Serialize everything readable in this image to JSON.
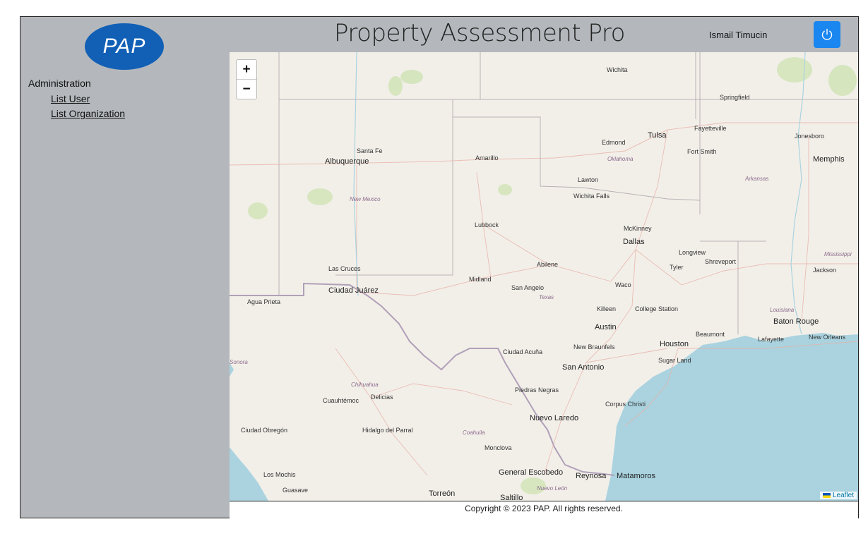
{
  "sidebar": {
    "logo_text": "PAP",
    "section_title": "Administration",
    "items": [
      {
        "label": "List User"
      },
      {
        "label": "List Organization"
      }
    ]
  },
  "header": {
    "title": "Property Assessment Pro",
    "user_name": "Ismail Timucin",
    "logout_icon": "power-icon"
  },
  "map": {
    "zoom_in": "+",
    "zoom_out": "−",
    "attribution": "Leaflet",
    "regions": [
      "New Mexico",
      "Oklahoma",
      "Arkansas",
      "Texas",
      "Louisiana",
      "Mississippi",
      "Chihuahua",
      "Coahuila",
      "Nuevo León",
      "Sonora"
    ],
    "cities": [
      "Wichita",
      "Springfield",
      "Tulsa",
      "Fayetteville",
      "Jonesboro",
      "Edmond",
      "Fort Smith",
      "Memphis",
      "Santa Fe",
      "Albuquerque",
      "Amarillo",
      "Lawton",
      "Wichita Falls",
      "Lubbock",
      "McKinney",
      "Dallas",
      "Longview",
      "Tyler",
      "Shreveport",
      "Jackson",
      "Las Cruces",
      "Abilene",
      "Ciudad Juárez",
      "Midland",
      "San Angelo",
      "Waco",
      "Agua Prieta",
      "Killeen",
      "College Station",
      "Baton Rouge",
      "Austin",
      "Beaumont",
      "Lafayette",
      "New Orleans",
      "New Braunfels",
      "Houston",
      "Sugar Land",
      "Ciudad Acuña",
      "San Antonio",
      "Piedras Negras",
      "Cuauhtémoc",
      "Delicias",
      "Corpus Christi",
      "Nuevo Laredo",
      "Ciudad Obregón",
      "Hidalgo del Parral",
      "Monclova",
      "General Escobedo",
      "Reynosa",
      "Matamoros",
      "Los Mochis",
      "Guasave",
      "Torreón",
      "Saltillo"
    ]
  },
  "footer": {
    "copyright": "Copyright © 2023 PAP. All rights reserved."
  },
  "colors": {
    "sidebar_bg": "#b4b8bc",
    "logo_bg": "#1260b6",
    "power_button_bg": "#1a86f0",
    "water": "#aad3df",
    "land": "#f2efe9"
  }
}
